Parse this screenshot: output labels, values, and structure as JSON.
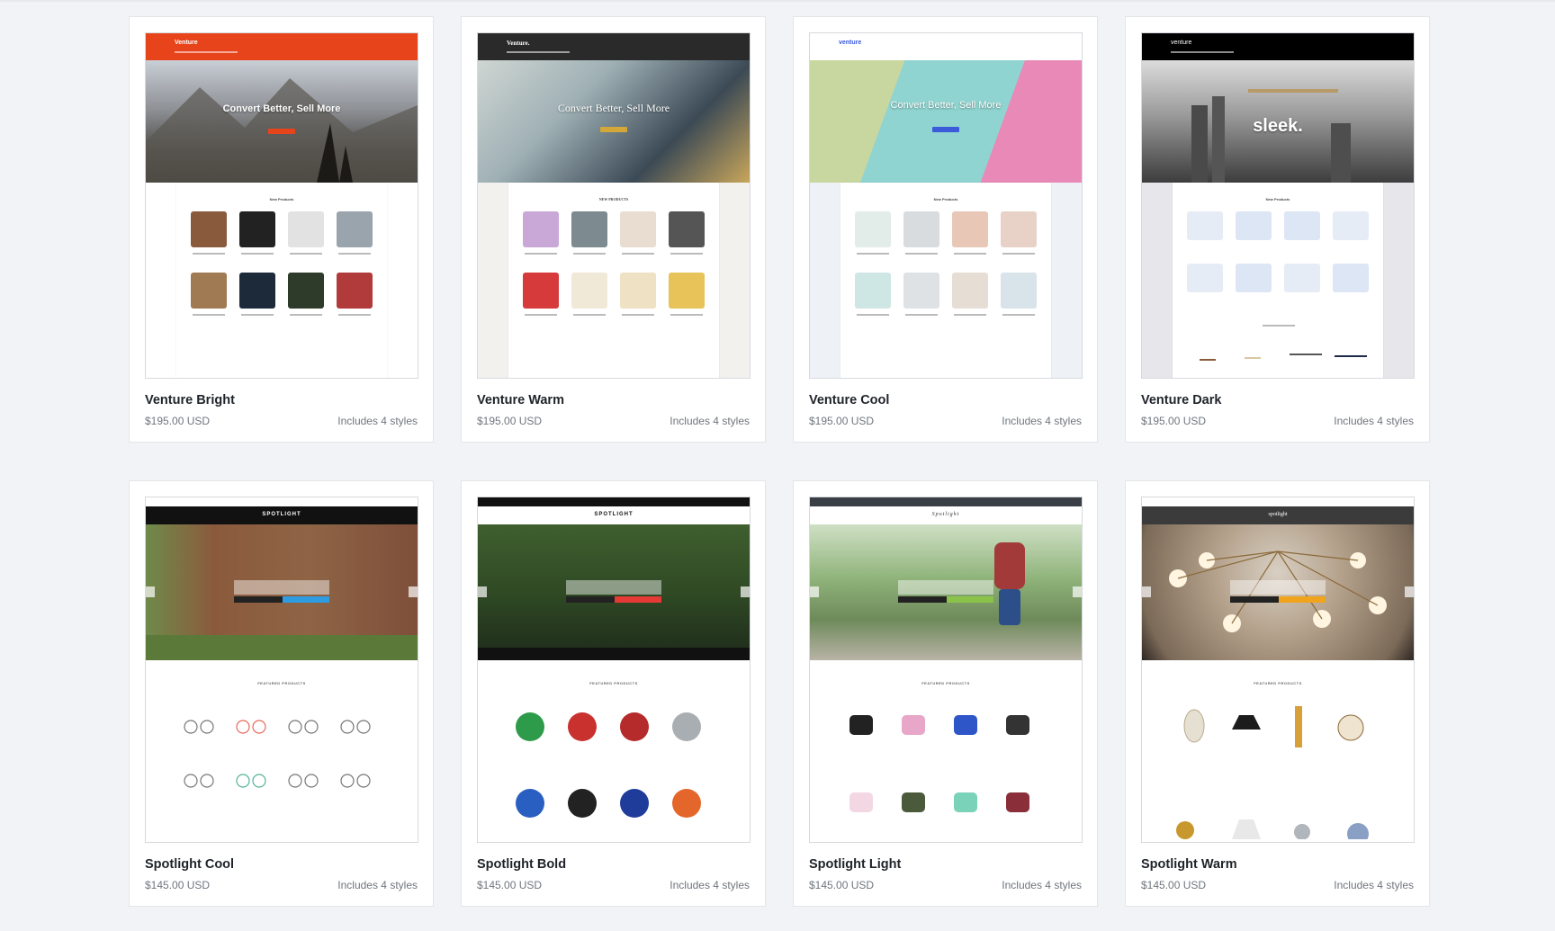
{
  "templates": [
    {
      "title": "Venture Bright",
      "price": "$195.00 USD",
      "styles": "Includes 4 styles"
    },
    {
      "title": "Venture Warm",
      "price": "$195.00 USD",
      "styles": "Includes 4 styles"
    },
    {
      "title": "Venture Cool",
      "price": "$195.00 USD",
      "styles": "Includes 4 styles"
    },
    {
      "title": "Venture Dark",
      "price": "$195.00 USD",
      "styles": "Includes 4 styles"
    },
    {
      "title": "Spotlight Cool",
      "price": "$145.00 USD",
      "styles": "Includes 4 styles"
    },
    {
      "title": "Spotlight Bold",
      "price": "$145.00 USD",
      "styles": "Includes 4 styles"
    },
    {
      "title": "Spotlight Light",
      "price": "$145.00 USD",
      "styles": "Includes 4 styles"
    },
    {
      "title": "Spotlight Warm",
      "price": "$145.00 USD",
      "styles": "Includes 4 styles"
    }
  ],
  "previews": {
    "venture_bright": {
      "logo": "Venture",
      "hero_text": "Convert Better, Sell More",
      "section": "New Products"
    },
    "venture_warm": {
      "logo": "Venture.",
      "hero_text": "Convert Better, Sell More",
      "section": "NEW PRODUCTS"
    },
    "venture_cool": {
      "logo": "venture",
      "hero_text": "Convert Better, Sell More",
      "section": "New Products"
    },
    "venture_dark": {
      "logo": "venture",
      "hero_text": "sleek.",
      "section": "New Products"
    },
    "spotlight_cool": {
      "logo": "SPOTLIGHT",
      "section": "FEATURED PRODUCTS"
    },
    "spotlight_bold": {
      "logo": "SPOTLIGHT",
      "section": "FEATURED PRODUCTS"
    },
    "spotlight_light": {
      "logo": "Spotlight",
      "section": "FEATURED PRODUCTS"
    },
    "spotlight_warm": {
      "logo": "spotlight",
      "section": "FEATURED PRODUCTS"
    }
  },
  "colors": {
    "venture_bright_accent": "#e8441b",
    "venture_warm_nav": "#2a2a2a",
    "venture_cool_accent": "#3b5bdb",
    "venture_dark_nav": "#000000",
    "spotlight_cool_cta": "#2f9be0",
    "spotlight_bold_cta": "#e53935",
    "spotlight_light_cta": "#8bc34a",
    "spotlight_warm_cta": "#f0a31c"
  }
}
